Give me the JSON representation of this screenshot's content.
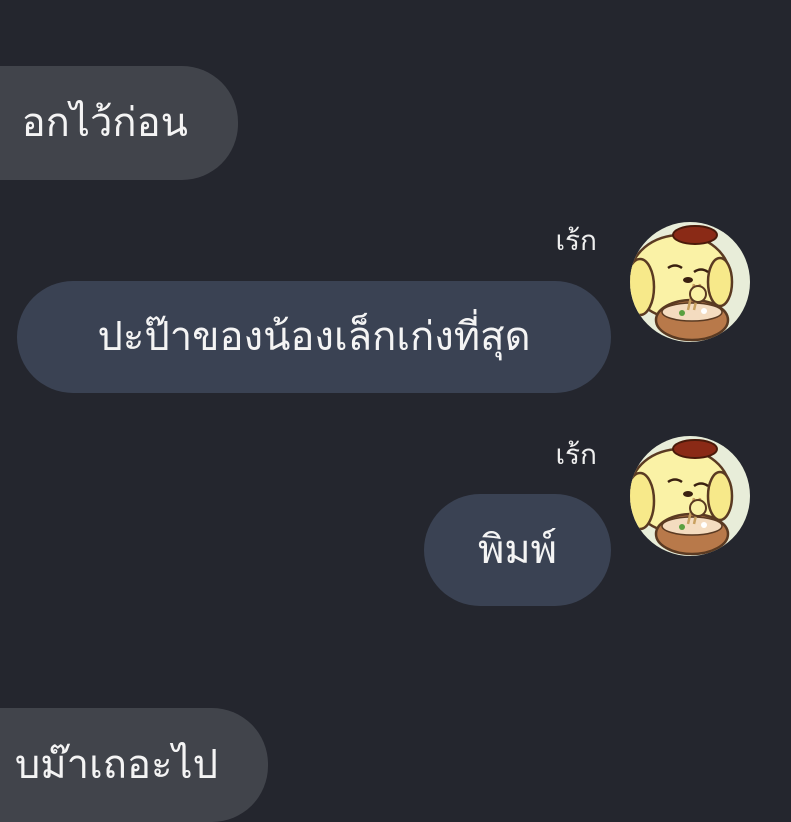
{
  "colors": {
    "background": "#24262e",
    "incoming_bubble": "#41444b",
    "outgoing_bubble": "#3a4253",
    "text": "#f4f4f4"
  },
  "messages": [
    {
      "side": "incoming",
      "text": "อกไว้ก่อน"
    },
    {
      "side": "outgoing",
      "sender": "เร้ก",
      "avatar": "pompompurin-avatar",
      "text": "ปะป๊าของน้องเล็กเก่งที่สุด"
    },
    {
      "side": "outgoing",
      "sender": "เร้ก",
      "avatar": "pompompurin-avatar",
      "text": "พิมพ์"
    },
    {
      "side": "incoming",
      "text": "บม๊าเถอะไป"
    }
  ]
}
